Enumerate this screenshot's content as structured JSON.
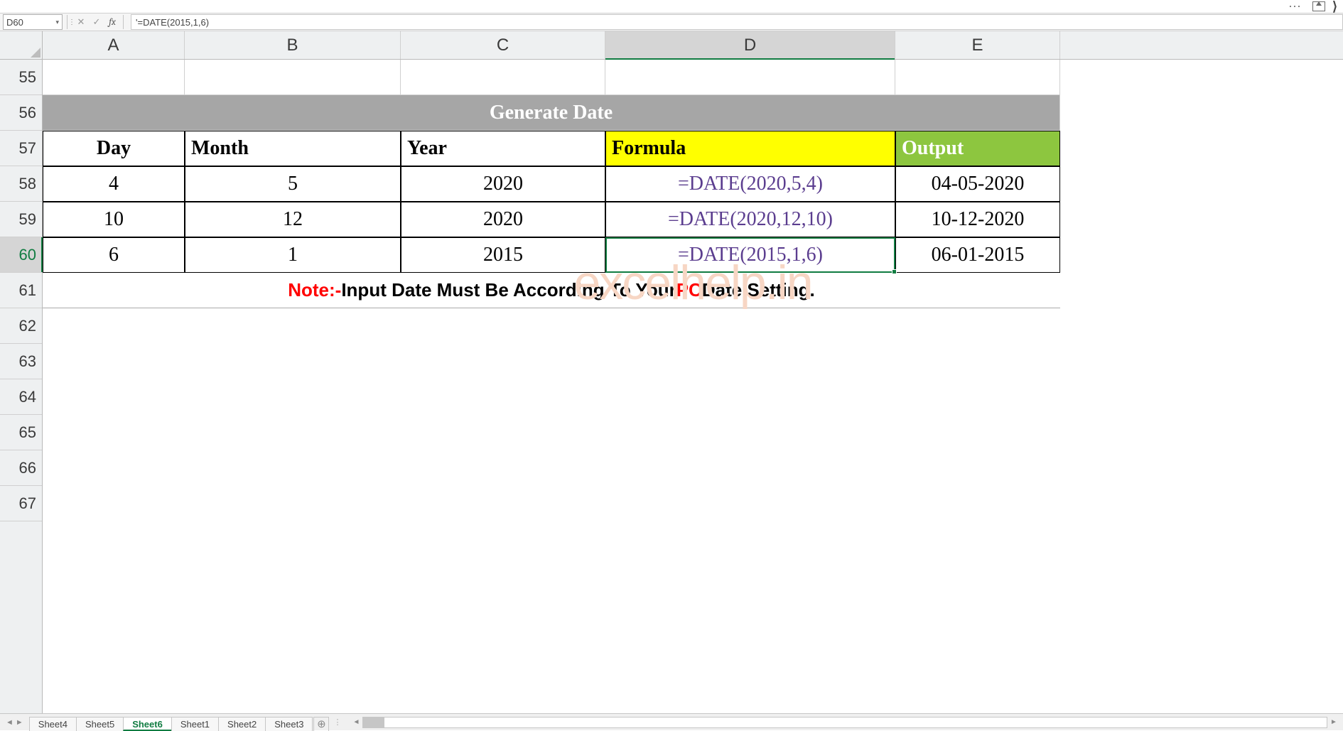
{
  "titlebar": {
    "dots": "⋯"
  },
  "namebox": {
    "value": "D60"
  },
  "formula_bar": {
    "cancel": "✕",
    "confirm": "✓",
    "fx": "fx",
    "value": "'=DATE(2015,1,6)"
  },
  "columns": [
    "A",
    "B",
    "C",
    "D",
    "E"
  ],
  "row_numbers": [
    55,
    56,
    57,
    58,
    59,
    60,
    61,
    62,
    63,
    64,
    65,
    66,
    67
  ],
  "banner": "Generate Date",
  "headers": {
    "A": "Day",
    "B": "Month",
    "C": "Year",
    "D": "Formula",
    "E": "Output"
  },
  "rows": [
    {
      "day": "4",
      "month": "5",
      "year": "2020",
      "formula": "=DATE(2020,5,4)",
      "output": "04-05-2020"
    },
    {
      "day": "10",
      "month": "12",
      "year": "2020",
      "formula": "=DATE(2020,12,10)",
      "output": "10-12-2020"
    },
    {
      "day": "6",
      "month": "1",
      "year": "2015",
      "formula": "=DATE(2015,1,6)",
      "output": "06-01-2015"
    }
  ],
  "note": {
    "red1": "Note:-",
    "mid": " Input Date Must Be According To Your ",
    "red2": "PC",
    "tail": " Date Setting."
  },
  "watermark": "excelhelp.in",
  "tabs": [
    "Sheet4",
    "Sheet5",
    "Sheet6",
    "Sheet1",
    "Sheet2",
    "Sheet3"
  ],
  "active_tab": "Sheet6",
  "selected_cell": "D60"
}
